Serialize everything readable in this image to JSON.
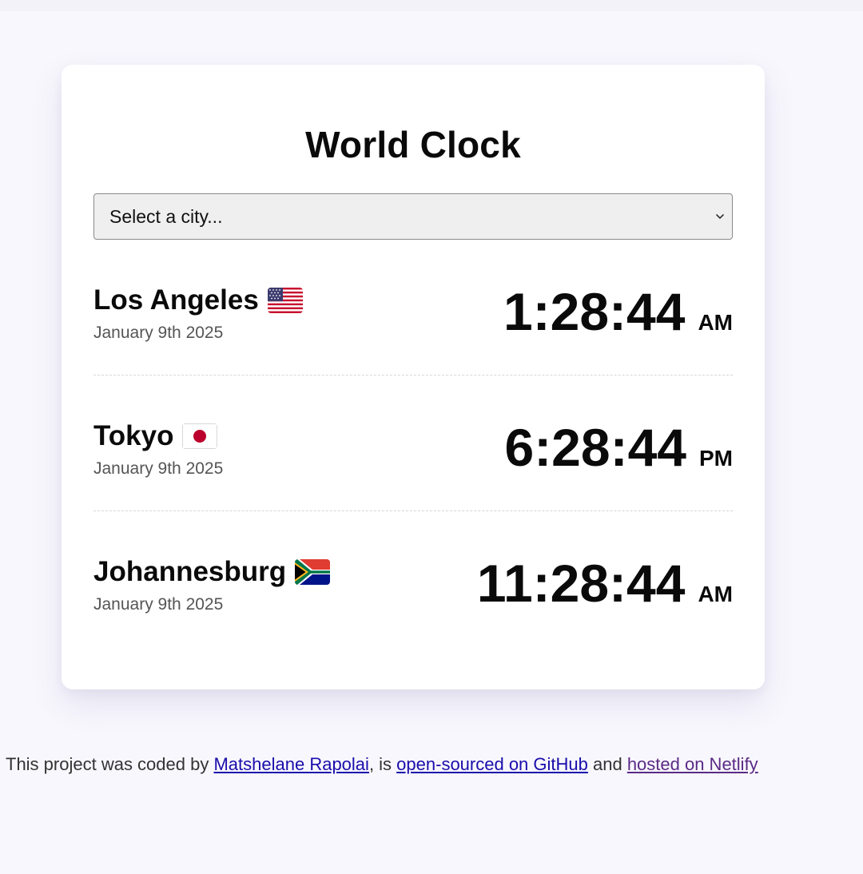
{
  "app": {
    "title": "World Clock"
  },
  "city_select": {
    "selected_label": "Select a city..."
  },
  "cities": [
    {
      "name": "Los Angeles",
      "flag_icon": "us-flag-icon",
      "date": "January 9th 2025",
      "time": "1:28:44",
      "ampm": "AM"
    },
    {
      "name": "Tokyo",
      "flag_icon": "japan-flag-icon",
      "date": "January 9th 2025",
      "time": "6:28:44",
      "ampm": "PM"
    },
    {
      "name": "Johannesburg",
      "flag_icon": "south-africa-flag-icon",
      "date": "January 9th 2025",
      "time": "11:28:44",
      "ampm": "AM"
    }
  ],
  "footer": {
    "prefix": "This project was coded by ",
    "author_link": "Matshelane Rapolai",
    "middle": ", is ",
    "github_link": "open-sourced on GitHub",
    "and_text": " and ",
    "netlify_link": "hosted on Netlify"
  },
  "colors": {
    "page_background": "#f8f7fd",
    "card_background": "#ffffff",
    "link": "#1a0dab",
    "visited_link": "#5b2a86"
  }
}
